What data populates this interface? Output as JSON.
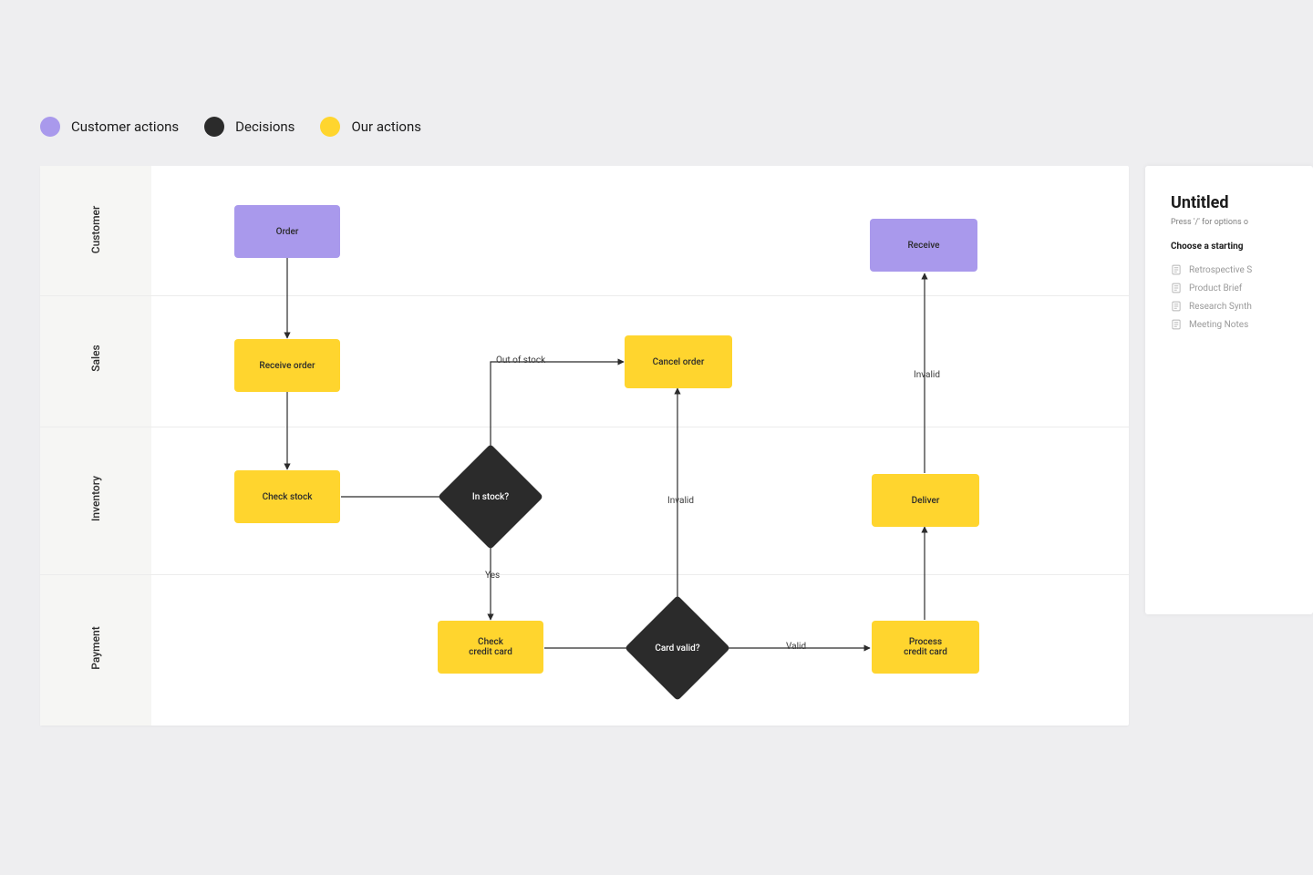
{
  "legend": {
    "customer_actions": "Customer actions",
    "decisions": "Decisions",
    "our_actions": "Our actions"
  },
  "lanes": {
    "customer": "Customer",
    "sales": "Sales",
    "inventory": "Inventory",
    "payment": "Payment"
  },
  "nodes": {
    "order": "Order",
    "receive": "Receive",
    "receive_order": "Receive order",
    "cancel_order": "Cancel order",
    "check_stock": "Check stock",
    "in_stock": "In stock?",
    "deliver": "Deliver",
    "check_credit_card_l1": "Check",
    "check_credit_card_l2": "credit card",
    "card_valid": "Card valid?",
    "process_credit_card_l1": "Process",
    "process_credit_card_l2": "credit card"
  },
  "edges": {
    "out_of_stock": "Out of stock",
    "yes": "Yes",
    "invalid_up": "Invalid",
    "invalid_right": "Invalid",
    "valid": "Valid"
  },
  "panel": {
    "title": "Untitled",
    "hint": "Press '/' for options o",
    "choose": "Choose a starting",
    "templates": {
      "retro": "Retrospective S",
      "brief": "Product Brief",
      "research": "Research Synth",
      "meeting": "Meeting Notes"
    }
  },
  "chart_data": {
    "type": "swimlane-flowchart",
    "title": "",
    "legend": [
      {
        "label": "Customer actions",
        "color": "#a999ec"
      },
      {
        "label": "Decisions",
        "color": "#2b2b2b"
      },
      {
        "label": "Our actions",
        "color": "#ffd52e"
      }
    ],
    "lanes": [
      "Customer",
      "Sales",
      "Inventory",
      "Payment"
    ],
    "nodes": [
      {
        "id": "order",
        "label": "Order",
        "lane": "Customer",
        "kind": "customer-action"
      },
      {
        "id": "receive",
        "label": "Receive",
        "lane": "Customer",
        "kind": "customer-action"
      },
      {
        "id": "receive_order",
        "label": "Receive order",
        "lane": "Sales",
        "kind": "our-action"
      },
      {
        "id": "cancel_order",
        "label": "Cancel order",
        "lane": "Sales",
        "kind": "our-action"
      },
      {
        "id": "check_stock",
        "label": "Check stock",
        "lane": "Inventory",
        "kind": "our-action"
      },
      {
        "id": "in_stock",
        "label": "In stock?",
        "lane": "Inventory",
        "kind": "decision"
      },
      {
        "id": "deliver",
        "label": "Deliver",
        "lane": "Inventory",
        "kind": "our-action"
      },
      {
        "id": "check_credit_card",
        "label": "Check credit card",
        "lane": "Payment",
        "kind": "our-action"
      },
      {
        "id": "card_valid",
        "label": "Card valid?",
        "lane": "Payment",
        "kind": "decision"
      },
      {
        "id": "process_credit_card",
        "label": "Process credit card",
        "lane": "Payment",
        "kind": "our-action"
      }
    ],
    "edges": [
      {
        "from": "order",
        "to": "receive_order",
        "label": ""
      },
      {
        "from": "receive_order",
        "to": "check_stock",
        "label": ""
      },
      {
        "from": "check_stock",
        "to": "in_stock",
        "label": ""
      },
      {
        "from": "in_stock",
        "to": "cancel_order",
        "label": "Out of stock"
      },
      {
        "from": "in_stock",
        "to": "check_credit_card",
        "label": "Yes"
      },
      {
        "from": "check_credit_card",
        "to": "card_valid",
        "label": ""
      },
      {
        "from": "card_valid",
        "to": "cancel_order",
        "label": "Invalid"
      },
      {
        "from": "card_valid",
        "to": "process_credit_card",
        "label": "Valid"
      },
      {
        "from": "process_credit_card",
        "to": "deliver",
        "label": ""
      },
      {
        "from": "deliver",
        "to": "receive",
        "label": "Invalid"
      }
    ]
  }
}
